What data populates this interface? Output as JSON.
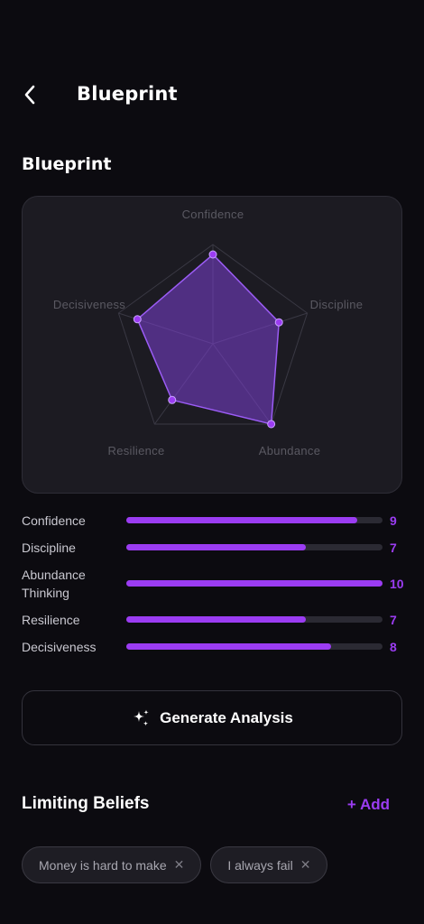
{
  "header": {
    "title": "Blueprint"
  },
  "section": {
    "title": "Blueprint"
  },
  "chart_data": {
    "type": "radar",
    "axes": [
      "Confidence",
      "Discipline",
      "Abundance",
      "Resilience",
      "Decisiveness"
    ],
    "values": [
      9,
      7,
      10,
      7,
      8
    ],
    "colors": {
      "fill": "#7b3fd1",
      "stroke": "#9b5cf5",
      "grid": "#3a3944"
    }
  },
  "scores": [
    {
      "label": "Confidence",
      "value": "9",
      "ratio": 0.9
    },
    {
      "label": "Discipline",
      "value": "7",
      "ratio": 0.7
    },
    {
      "label": "Abundance Thinking",
      "value": "10",
      "ratio": 1.0
    },
    {
      "label": "Resilience",
      "value": "7",
      "ratio": 0.7
    },
    {
      "label": "Decisiveness",
      "value": "8",
      "ratio": 0.8
    }
  ],
  "generate_button": {
    "label": "Generate Analysis",
    "icon": "sparkles-icon"
  },
  "limiting_beliefs": {
    "title": "Limiting Beliefs",
    "add_label": "+ Add",
    "items": [
      "Money is hard to make",
      "I always fail"
    ]
  },
  "colors": {
    "accent": "#9b3cf2",
    "background": "#0c0b10",
    "card": "#1c1b22"
  }
}
